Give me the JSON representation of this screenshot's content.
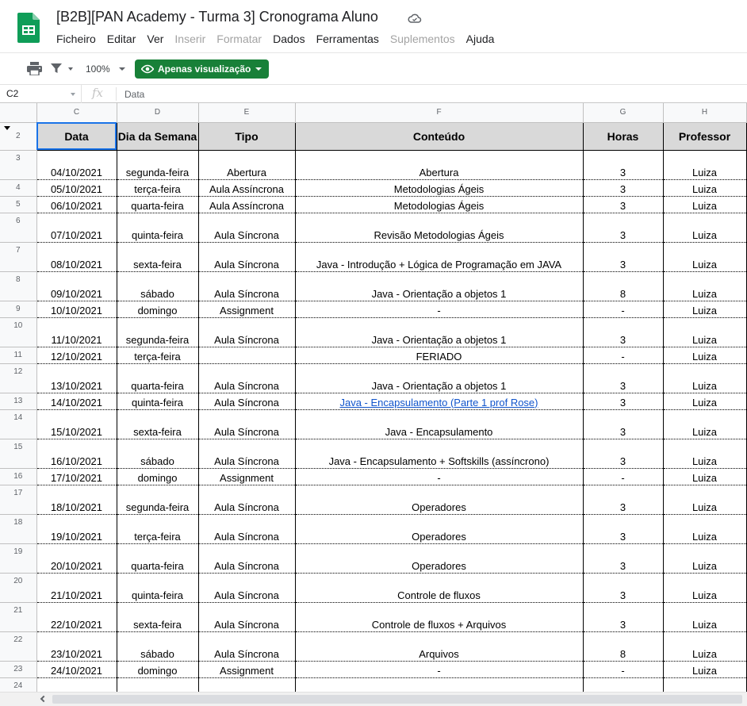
{
  "header": {
    "title": "[B2B][PAN Academy - Turma 3] Cronograma Aluno",
    "menu": [
      {
        "label": "Ficheiro",
        "enabled": true
      },
      {
        "label": "Editar",
        "enabled": true
      },
      {
        "label": "Ver",
        "enabled": true
      },
      {
        "label": "Inserir",
        "enabled": false
      },
      {
        "label": "Formatar",
        "enabled": false
      },
      {
        "label": "Dados",
        "enabled": true
      },
      {
        "label": "Ferramentas",
        "enabled": true
      },
      {
        "label": "Suplementos",
        "enabled": false
      },
      {
        "label": "Ajuda",
        "enabled": true
      }
    ]
  },
  "toolbar": {
    "zoom": "100%",
    "view_only_label": "Apenas visualização"
  },
  "formula_bar": {
    "cell_ref": "C2",
    "fx": "fx",
    "content": "Data"
  },
  "grid": {
    "column_letters": [
      "C",
      "D",
      "E",
      "F",
      "G",
      "H"
    ],
    "header_row_number": "2",
    "headers": [
      "Data",
      "Dia da Semana",
      "Tipo",
      "Conteúdo",
      "Horas",
      "Professor"
    ],
    "rows": [
      {
        "n": "3",
        "cells": [
          "04/10/2021",
          "segunda-feira",
          "Abertura",
          "Abertura",
          "3",
          "Luiza"
        ],
        "tall": true
      },
      {
        "n": "4",
        "cells": [
          "05/10/2021",
          "terça-feira",
          "Aula Assíncrona",
          "Metodologias Ágeis",
          "3",
          "Luiza"
        ],
        "tall": false
      },
      {
        "n": "5",
        "cells": [
          "06/10/2021",
          "quarta-feira",
          "Aula Assíncrona",
          "Metodologias Ágeis",
          "3",
          "Luiza"
        ],
        "tall": false
      },
      {
        "n": "6",
        "cells": [
          "07/10/2021",
          "quinta-feira",
          "Aula Síncrona",
          "Revisão Metodologias Ágeis",
          "3",
          "Luiza"
        ],
        "tall": true
      },
      {
        "n": "7",
        "cells": [
          "08/10/2021",
          "sexta-feira",
          "Aula Síncrona",
          "Java - Introdução + Lógica de Programação em JAVA",
          "3",
          "Luiza"
        ],
        "tall": true
      },
      {
        "n": "8",
        "cells": [
          "09/10/2021",
          "sábado",
          "Aula Síncrona",
          "Java - Orientação a objetos 1",
          "8",
          "Luiza"
        ],
        "tall": true
      },
      {
        "n": "9",
        "cells": [
          "10/10/2021",
          "domingo",
          "Assignment",
          "-",
          "-",
          "Luiza"
        ],
        "tall": false
      },
      {
        "n": "10",
        "cells": [
          "11/10/2021",
          "segunda-feira",
          "Aula Síncrona",
          "Java - Orientação a objetos 1",
          "3",
          "Luiza"
        ],
        "tall": true
      },
      {
        "n": "11",
        "cells": [
          "12/10/2021",
          "terça-feira",
          "",
          "FERIADO",
          "-",
          "Luiza"
        ],
        "tall": false
      },
      {
        "n": "12",
        "cells": [
          "13/10/2021",
          "quarta-feira",
          "Aula Síncrona",
          "Java - Orientação a objetos 1",
          "3",
          "Luiza"
        ],
        "tall": true
      },
      {
        "n": "13",
        "cells": [
          "14/10/2021",
          "quinta-feira",
          "Aula Síncrona",
          "Java - Encapsulamento (Parte 1 prof Rose)",
          "3",
          "Luiza"
        ],
        "tall": false,
        "link": true
      },
      {
        "n": "14",
        "cells": [
          "15/10/2021",
          "sexta-feira",
          "Aula Síncrona",
          "Java - Encapsulamento",
          "3",
          "Luiza"
        ],
        "tall": true
      },
      {
        "n": "15",
        "cells": [
          "16/10/2021",
          "sábado",
          "Aula Síncrona",
          "Java - Encapsulamento + Softskills (assíncrono)",
          "3",
          "Luiza"
        ],
        "tall": true
      },
      {
        "n": "16",
        "cells": [
          "17/10/2021",
          "domingo",
          "Assignment",
          "-",
          "-",
          "Luiza"
        ],
        "tall": false
      },
      {
        "n": "17",
        "cells": [
          "18/10/2021",
          "segunda-feira",
          "Aula Síncrona",
          "Operadores",
          "3",
          "Luiza"
        ],
        "tall": true
      },
      {
        "n": "18",
        "cells": [
          "19/10/2021",
          "terça-feira",
          "Aula Síncrona",
          "Operadores",
          "3",
          "Luiza"
        ],
        "tall": true
      },
      {
        "n": "19",
        "cells": [
          "20/10/2021",
          "quarta-feira",
          "Aula Síncrona",
          "Operadores",
          "3",
          "Luiza"
        ],
        "tall": true
      },
      {
        "n": "20",
        "cells": [
          "21/10/2021",
          "quinta-feira",
          "Aula Síncrona",
          "Controle de fluxos",
          "3",
          "Luiza"
        ],
        "tall": true
      },
      {
        "n": "21",
        "cells": [
          "22/10/2021",
          "sexta-feira",
          "Aula Síncrona",
          "Controle de fluxos  + Arquivos",
          "3",
          "Luiza"
        ],
        "tall": true
      },
      {
        "n": "22",
        "cells": [
          "23/10/2021",
          "sábado",
          "Aula Síncrona",
          "Arquivos",
          "8",
          "Luiza"
        ],
        "tall": true
      },
      {
        "n": "23",
        "cells": [
          "24/10/2021",
          "domingo",
          "Assignment",
          "-",
          "-",
          "Luiza"
        ],
        "tall": false
      },
      {
        "n": "24",
        "cells": [
          "",
          "",
          "",
          "",
          "",
          ""
        ],
        "tall": true
      }
    ]
  },
  "colors": {
    "sheets_green": "#0f9d58",
    "view_button": "#188038",
    "selection_blue": "#1a73e8",
    "header_fill": "#d9d9d9",
    "link": "#1155cc"
  }
}
